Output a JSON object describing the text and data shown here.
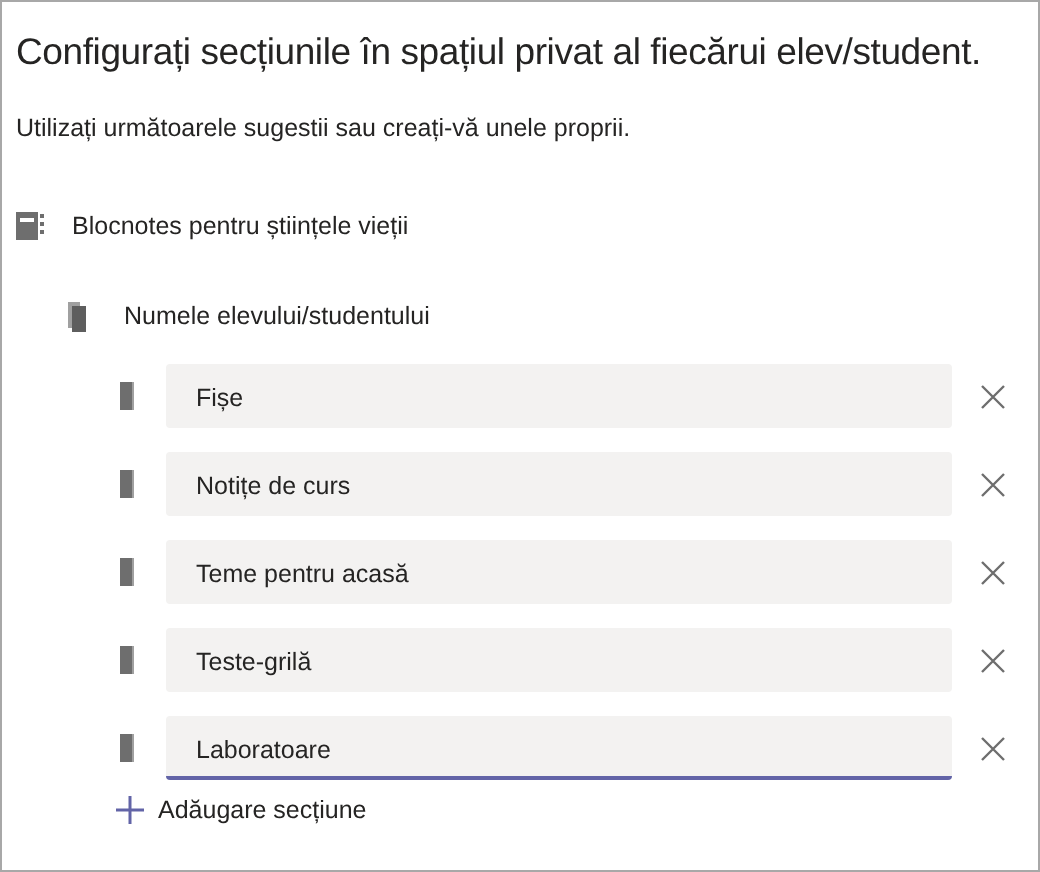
{
  "heading": "Configurați secțiunile în spațiul privat al fiecărui elev/student.",
  "subheading": "Utilizați următoarele sugestii sau creați-vă unele proprii.",
  "notebook": {
    "label": "Blocnotes pentru științele vieții"
  },
  "student_folder": {
    "label": "Numele elevului/studentului"
  },
  "sections": [
    {
      "value": "Fișe",
      "focused": false
    },
    {
      "value": "Notițe de curs",
      "focused": false
    },
    {
      "value": "Teme pentru acasă",
      "focused": false
    },
    {
      "value": "Teste-grilă",
      "focused": false
    },
    {
      "value": "Laboratoare",
      "focused": true
    }
  ],
  "add_section": {
    "label": "Adăugare secțiune"
  }
}
